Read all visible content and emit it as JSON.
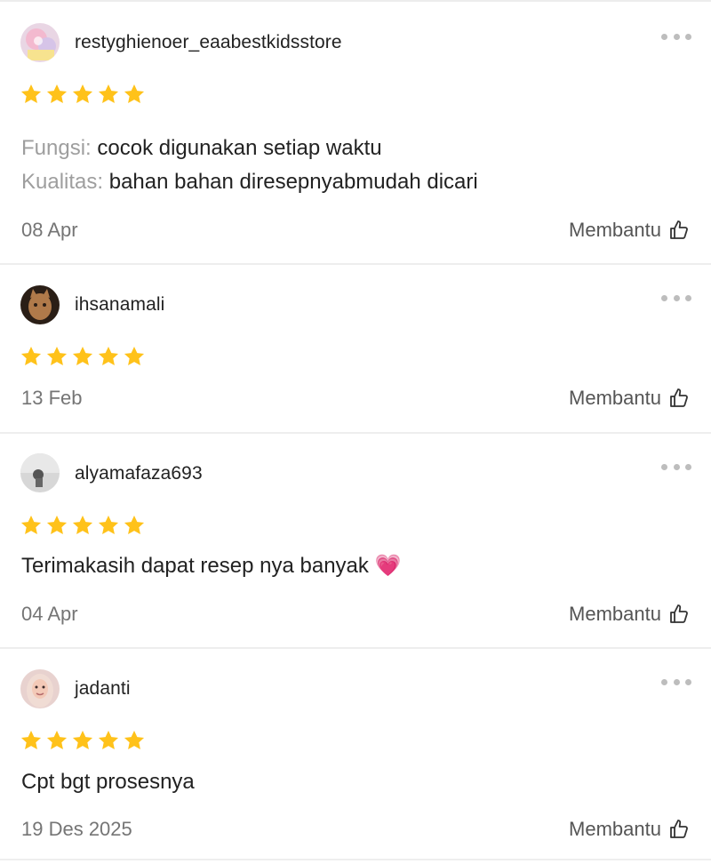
{
  "reviews": [
    {
      "username": "restyghienoer_eaabestkidsstore",
      "rating": 5,
      "lines": [
        {
          "label": "Fungsi:",
          "text": "cocok digunakan setiap waktu"
        },
        {
          "label": "Kualitas:",
          "text": "bahan bahan diresepnyabmudah dicari"
        }
      ],
      "date": "08 Apr",
      "helpful_label": "Membantu"
    },
    {
      "username": "ihsanamali",
      "rating": 5,
      "lines": [],
      "date": "13 Feb",
      "helpful_label": "Membantu"
    },
    {
      "username": "alyamafaza693",
      "rating": 5,
      "body": "Terimakasih dapat resep nya banyak 💗",
      "date": "04 Apr",
      "helpful_label": "Membantu"
    },
    {
      "username": "jadanti",
      "rating": 5,
      "body": "Cpt bgt prosesnya",
      "date": "19 Des 2025",
      "helpful_label": "Membantu"
    }
  ],
  "colors": {
    "star": "#FFC21A",
    "label_gray": "#9E9E9E",
    "date_gray": "#757575",
    "divider": "#EEEEEE"
  },
  "icons": {
    "more": "more-dots-icon",
    "helpful": "thumbs-up-icon",
    "star": "star-icon"
  }
}
